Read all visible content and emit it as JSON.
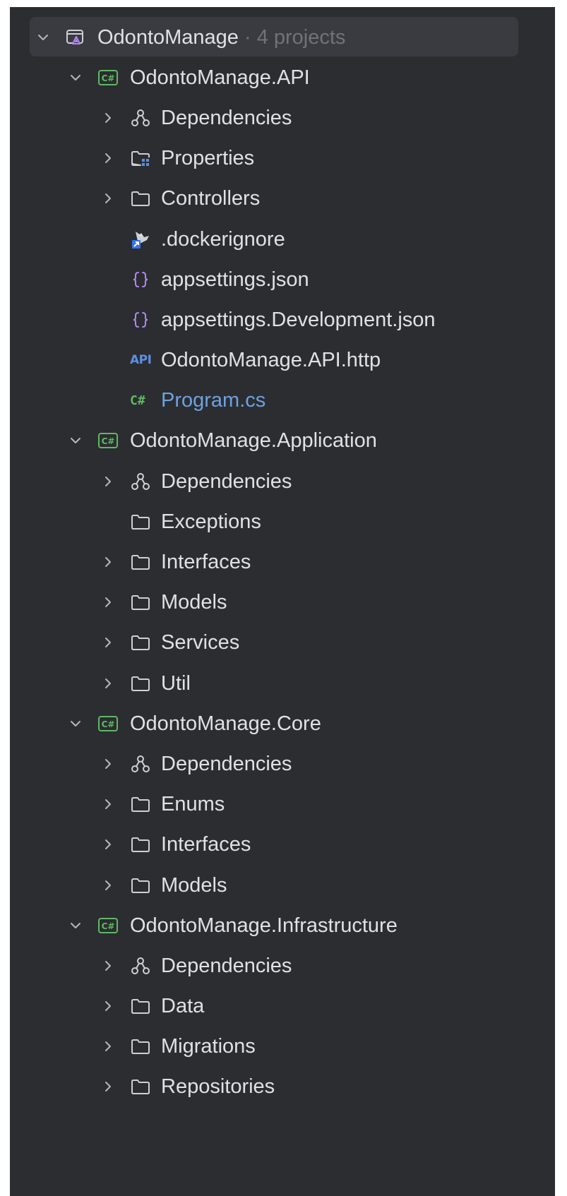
{
  "solution": {
    "name": "OdontoManage",
    "suffix": " · 4 projects",
    "icon": "solution-icon"
  },
  "projects": [
    {
      "name": "OdontoManage.API",
      "icon": "csharp-project-icon",
      "children": [
        {
          "label": "Dependencies",
          "icon": "dependencies-icon",
          "expandable": true
        },
        {
          "label": "Properties",
          "icon": "properties-folder-icon",
          "expandable": true
        },
        {
          "label": "Controllers",
          "icon": "folder-icon",
          "expandable": true
        },
        {
          "label": ".dockerignore",
          "icon": "docker-icon",
          "expandable": false
        },
        {
          "label": "appsettings.json",
          "icon": "json-icon",
          "expandable": false
        },
        {
          "label": "appsettings.Development.json",
          "icon": "json-icon",
          "expandable": false
        },
        {
          "label": "OdontoManage.API.http",
          "icon": "api-http-icon",
          "expandable": false
        },
        {
          "label": "Program.cs",
          "icon": "csharp-file-icon",
          "expandable": false
        }
      ]
    },
    {
      "name": "OdontoManage.Application",
      "icon": "csharp-project-icon",
      "children": [
        {
          "label": "Dependencies",
          "icon": "dependencies-icon",
          "expandable": true
        },
        {
          "label": "Exceptions",
          "icon": "folder-icon",
          "expandable": false
        },
        {
          "label": "Interfaces",
          "icon": "folder-icon",
          "expandable": true
        },
        {
          "label": "Models",
          "icon": "folder-icon",
          "expandable": true
        },
        {
          "label": "Services",
          "icon": "folder-icon",
          "expandable": true
        },
        {
          "label": "Util",
          "icon": "folder-icon",
          "expandable": true
        }
      ]
    },
    {
      "name": "OdontoManage.Core",
      "icon": "csharp-project-icon",
      "children": [
        {
          "label": "Dependencies",
          "icon": "dependencies-icon",
          "expandable": true
        },
        {
          "label": "Enums",
          "icon": "folder-icon",
          "expandable": true
        },
        {
          "label": "Interfaces",
          "icon": "folder-icon",
          "expandable": true
        },
        {
          "label": "Models",
          "icon": "folder-icon",
          "expandable": true
        }
      ]
    },
    {
      "name": "OdontoManage.Infrastructure",
      "icon": "csharp-project-icon",
      "children": [
        {
          "label": "Dependencies",
          "icon": "dependencies-icon",
          "expandable": true
        },
        {
          "label": "Data",
          "icon": "folder-icon",
          "expandable": true
        },
        {
          "label": "Migrations",
          "icon": "folder-icon",
          "expandable": true
        },
        {
          "label": "Repositories",
          "icon": "folder-icon",
          "expandable": true
        }
      ]
    }
  ],
  "badges": {
    "csharp_project": "C#",
    "csharp_file": "C#",
    "api_http": "API"
  },
  "colors": {
    "panel_bg": "#2b2d30",
    "selection_bg": "#393b40",
    "text": "#dfe1e5",
    "muted_text": "#6f737a",
    "csharp_green": "#5fb865",
    "json_purple": "#b189f5",
    "api_blue": "#5c8fe6",
    "program_cs_text": "#6ea1e0"
  }
}
